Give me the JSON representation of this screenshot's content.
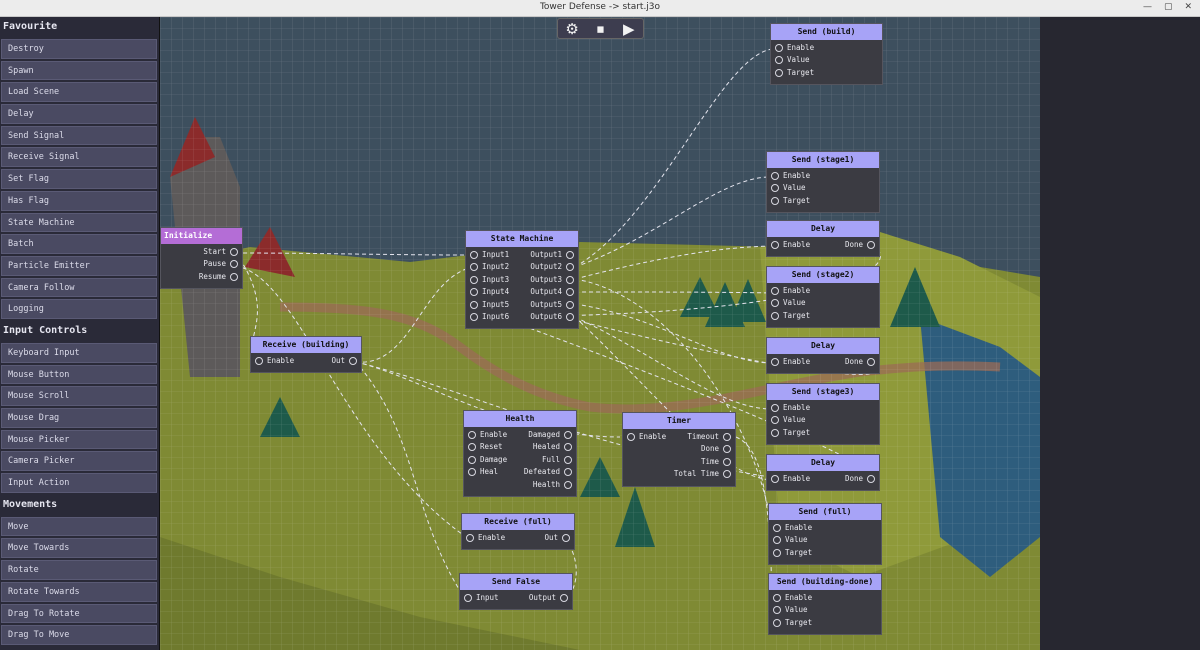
{
  "window": {
    "title": "Tower Defense -> start.j3o"
  },
  "sidebar": {
    "sections": [
      {
        "title": "Favourite",
        "items": [
          "Destroy",
          "Spawn",
          "Load Scene",
          "Delay",
          "Send Signal",
          "Receive Signal",
          "Set Flag",
          "Has Flag",
          "State Machine",
          "Batch",
          "Particle Emitter",
          "Camera Follow",
          "Logging"
        ]
      },
      {
        "title": "Input Controls",
        "items": [
          "Keyboard Input",
          "Mouse Button",
          "Mouse Scroll",
          "Mouse Drag",
          "Mouse Picker",
          "Camera Picker",
          "Input Action"
        ]
      },
      {
        "title": "Movements",
        "items": [
          "Move",
          "Move Towards",
          "Rotate",
          "Rotate Towards",
          "Drag To Rotate",
          "Drag To Move"
        ]
      }
    ]
  },
  "toolbar": {
    "icons": [
      "gear-icon",
      "stop-icon",
      "play-icon"
    ],
    "glyphs": [
      "⚙",
      "⏹",
      "▶"
    ]
  },
  "colors": {
    "node_header": "#a7a3f7",
    "initialize_header": "#b46dd6",
    "node_body": "#3b3b42",
    "grass": "#8f9a3a",
    "water": "#2b5a7a"
  },
  "nodes": {
    "initialize": {
      "title": "Initialize",
      "outputs": [
        "Start",
        "Pause",
        "Resume"
      ]
    },
    "receive_building": {
      "title": "Receive (building)",
      "inputs": [
        "Enable"
      ],
      "outputs": [
        "Out"
      ]
    },
    "state_machine": {
      "title": "State Machine",
      "inputs": [
        "Input1",
        "Input2",
        "Input3",
        "Input4",
        "Input5",
        "Input6"
      ],
      "outputs": [
        "Output1",
        "Output2",
        "Output3",
        "Output4",
        "Output5",
        "Output6"
      ]
    },
    "health": {
      "title": "Health",
      "inputs": [
        "Enable",
        "Reset",
        "Damage",
        "Heal"
      ],
      "outputs": [
        "Damaged",
        "Healed",
        "Full",
        "Defeated",
        "Health"
      ]
    },
    "timer": {
      "title": "Timer",
      "inputs": [
        "Enable"
      ],
      "outputs": [
        "Timeout",
        "Done",
        "Time",
        "Total Time"
      ]
    },
    "receive_full": {
      "title": "Receive (full)",
      "inputs": [
        "Enable"
      ],
      "outputs": [
        "Out"
      ]
    },
    "send_false": {
      "title": "Send False",
      "inputs": [
        "Input"
      ],
      "outputs": [
        "Output"
      ]
    },
    "send_build": {
      "title": "Send (build)",
      "inputs": [
        "Enable",
        "Value",
        "Target"
      ]
    },
    "send_stage1": {
      "title": "Send (stage1)",
      "inputs": [
        "Enable",
        "Value",
        "Target"
      ]
    },
    "delay1": {
      "title": "Delay",
      "inputs": [
        "Enable"
      ],
      "outputs": [
        "Done"
      ]
    },
    "send_stage2": {
      "title": "Send (stage2)",
      "inputs": [
        "Enable",
        "Value",
        "Target"
      ]
    },
    "delay2": {
      "title": "Delay",
      "inputs": [
        "Enable"
      ],
      "outputs": [
        "Done"
      ]
    },
    "send_stage3": {
      "title": "Send (stage3)",
      "inputs": [
        "Enable",
        "Value",
        "Target"
      ]
    },
    "delay3": {
      "title": "Delay",
      "inputs": [
        "Enable"
      ],
      "outputs": [
        "Done"
      ]
    },
    "send_full": {
      "title": "Send (full)",
      "inputs": [
        "Enable",
        "Value",
        "Target"
      ]
    },
    "send_building_done": {
      "title": "Send (building-done)",
      "inputs": [
        "Enable",
        "Value",
        "Target"
      ]
    }
  }
}
